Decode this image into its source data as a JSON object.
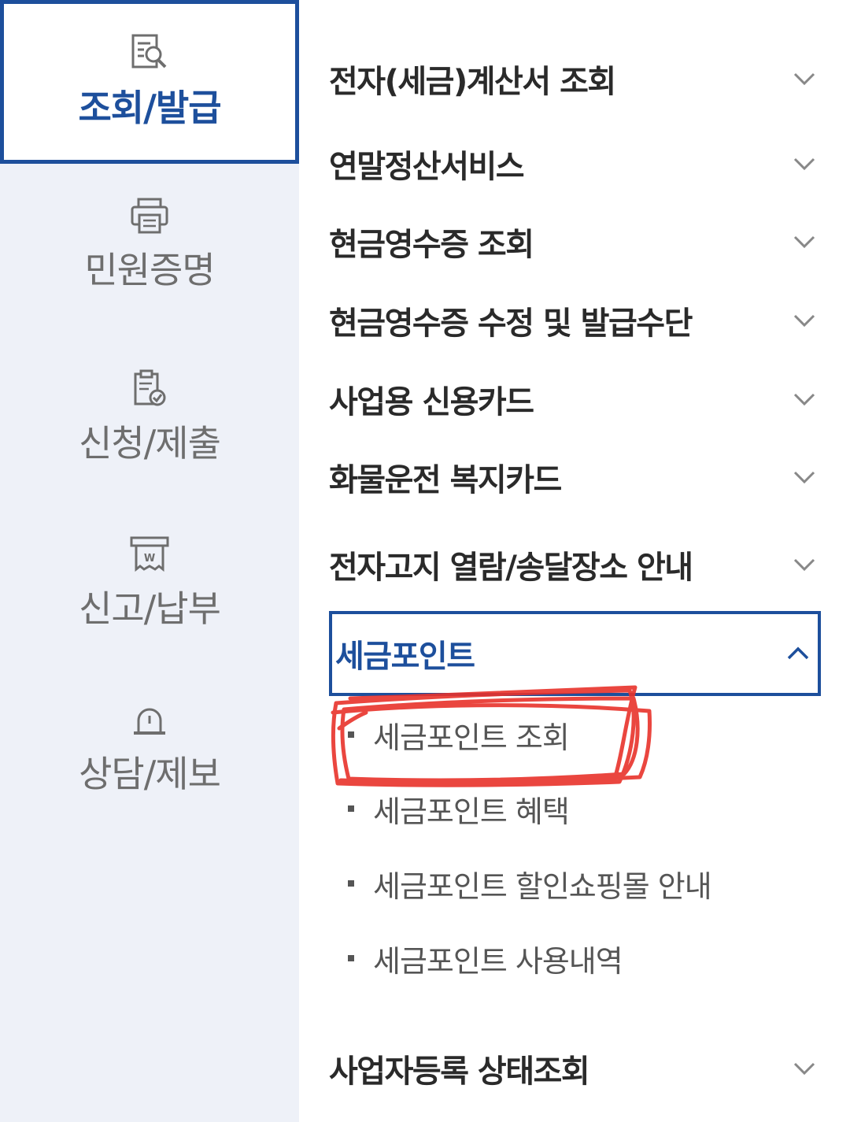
{
  "categories": [
    {
      "label": "조회/발급",
      "icon": "search-document-icon",
      "active": true
    },
    {
      "label": "민원증명",
      "icon": "printer-icon",
      "active": false
    },
    {
      "label": "신청/제출",
      "icon": "clipboard-check-icon",
      "active": false
    },
    {
      "label": "신고/납부",
      "icon": "receipt-won-icon",
      "active": false
    },
    {
      "label": "상담/제보",
      "icon": "alarm-bell-icon",
      "active": false
    }
  ],
  "menu": {
    "items": [
      {
        "label": "전자(세금)계산서 조회"
      },
      {
        "label": "연말정산서비스"
      },
      {
        "label": "현금영수증 조회"
      },
      {
        "label": "현금영수증 수정 및 발급수단"
      },
      {
        "label": "사업용 신용카드"
      },
      {
        "label": "화물운전 복지카드"
      },
      {
        "label": "전자고지 열람/송달장소 안내"
      },
      {
        "label": "세금포인트",
        "expanded": true
      },
      {
        "label": "사업자등록 상태조회"
      }
    ],
    "sub_items": [
      {
        "label": "세금포인트 조회"
      },
      {
        "label": "세금포인트 혜택"
      },
      {
        "label": "세금포인트 할인쇼핑몰 안내"
      },
      {
        "label": "세금포인트 사용내역"
      }
    ]
  },
  "colors": {
    "accent": "#1d4f9c",
    "rail_bg": "#eef1f8",
    "annotation": "#e8322b"
  }
}
